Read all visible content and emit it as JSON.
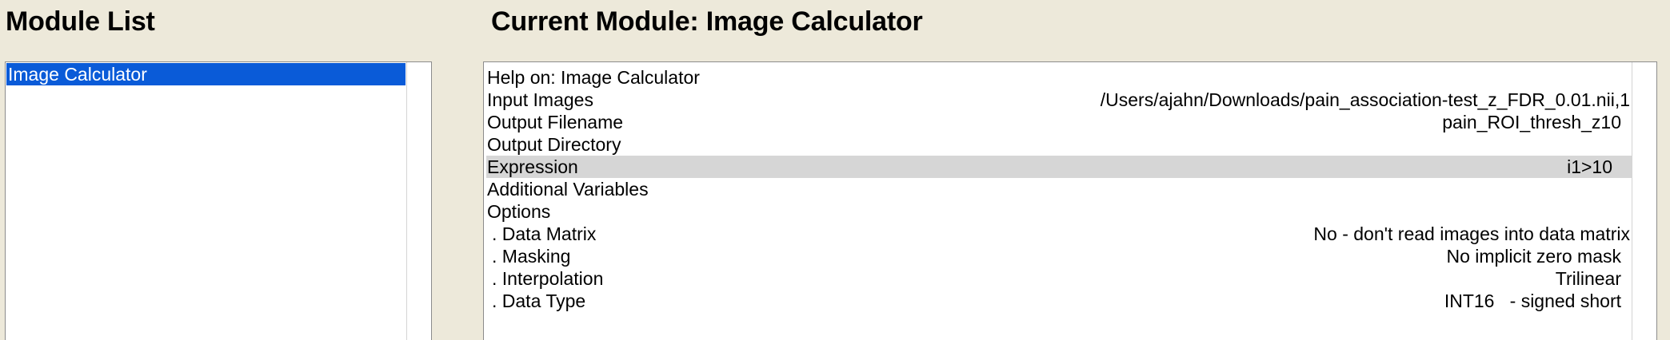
{
  "module_list": {
    "title": "Module List",
    "items": [
      {
        "label": "Image Calculator",
        "selected": true
      }
    ]
  },
  "current_module": {
    "title": "Current Module: Image Calculator",
    "rows": [
      {
        "label": "Help on: Image Calculator",
        "value": ""
      },
      {
        "label": "Input Images",
        "value": "/Users/ajahn/Downloads/pain_association-test_z_FDR_0.01.nii,1"
      },
      {
        "label": "Output Filename",
        "value": "pain_ROI_thresh_z10"
      },
      {
        "label": "Output Directory",
        "value": ""
      },
      {
        "label": "Expression",
        "value": "i1>10",
        "highlighted": true
      },
      {
        "label": "Additional Variables",
        "value": ""
      },
      {
        "label": "Options",
        "value": ""
      },
      {
        "label": ". Data Matrix",
        "value": "No - don't read images into data matrix"
      },
      {
        "label": ". Masking",
        "value": "No implicit zero mask"
      },
      {
        "label": ". Interpolation",
        "value": "Trilinear"
      },
      {
        "label": ". Data Type",
        "value": "INT16   - signed short"
      }
    ]
  },
  "colors": {
    "window_background": "#ede9da",
    "selection_blue": "#0a5bd8",
    "row_highlight": "#d6d6d6"
  }
}
